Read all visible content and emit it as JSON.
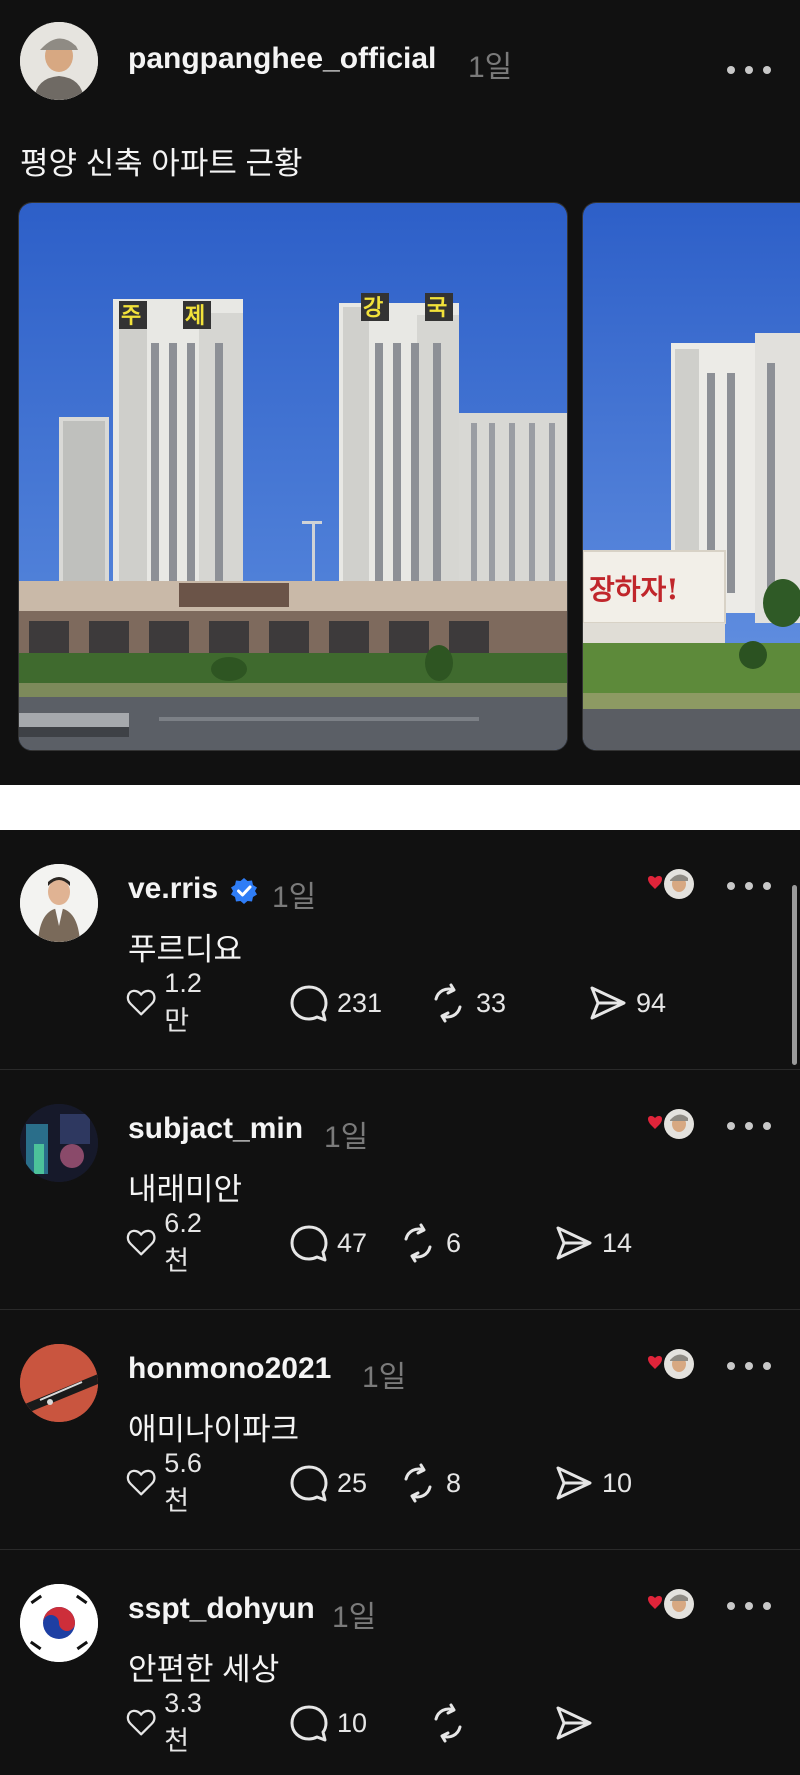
{
  "post": {
    "username": "pangpanghee_official",
    "time": "1일",
    "text": "평양 신축 아파트 근황",
    "avatar_icon": "user-avatar-icon",
    "photos": [
      {
        "sign_chars": [
          "주",
          "제",
          "강",
          "국"
        ]
      },
      {
        "banner_text": "장하자!"
      }
    ]
  },
  "replies": [
    {
      "username": "ve.rris",
      "verified": true,
      "time": "1일",
      "text": "푸르디요",
      "likes": "1.2만",
      "comments": "231",
      "reposts": "33",
      "shares": "94",
      "avatar": "person-suit"
    },
    {
      "username": "subjact_min",
      "verified": false,
      "time": "1일",
      "text": "내래미안",
      "likes": "6.2천",
      "comments": "47",
      "reposts": "6",
      "shares": "14",
      "avatar": "dark-scene"
    },
    {
      "username": "honmono2021",
      "verified": false,
      "time": "1일",
      "text": "애미나이파크",
      "likes": "5.6천",
      "comments": "25",
      "reposts": "8",
      "shares": "10",
      "avatar": "guitar"
    },
    {
      "username": "sspt_dohyun",
      "verified": false,
      "time": "1일",
      "text": "안편한 세상",
      "likes": "3.3천",
      "comments": "10",
      "reposts": "",
      "shares": "",
      "avatar": "korean-flag"
    }
  ],
  "colors": {
    "background": "#111111",
    "like_heart": "#e0243a",
    "verified": "#2f7df6",
    "sign_yellow": "#f2e23a",
    "banner_red": "#c0262b"
  }
}
